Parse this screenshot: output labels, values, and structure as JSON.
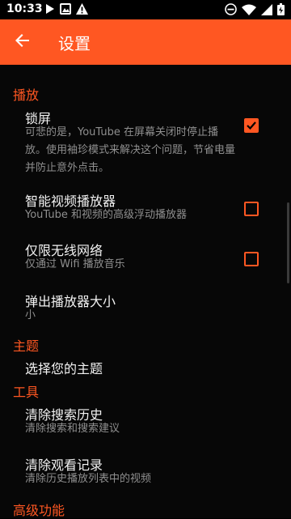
{
  "status_bar": {
    "time": "10:33",
    "left_icons": [
      "play-icon",
      "photo-icon",
      "warning-icon"
    ],
    "right_icons": [
      "dnd-icon",
      "wifi-icon",
      "signal-icon",
      "battery-icon"
    ]
  },
  "app_bar": {
    "title": "设置",
    "color": "#ff5722"
  },
  "sections": {
    "playback": {
      "title": "播放",
      "lockscreen": {
        "title": "锁屏",
        "desc": "可悲的是，YouTube 在屏幕关闭时停止播放。使用袖珍模式来解决这个问题，节省电量并防止意外点击。",
        "checked": true
      },
      "smart_player": {
        "title": "智能视频播放器",
        "desc": "YouTube 和视频的高级浮动播放器",
        "checked": false
      },
      "wifi_only": {
        "title": "仅限无线网络",
        "desc": "仅通过 Wifi 播放音乐",
        "checked": false
      },
      "popup_size": {
        "title": "弹出播放器大小",
        "value": "小"
      }
    },
    "theme": {
      "title": "主题",
      "choose": {
        "title": "选择您的主题"
      }
    },
    "tools": {
      "title": "工具",
      "clear_search": {
        "title": "清除搜索历史",
        "desc": "清除搜索和搜索建议"
      },
      "clear_history": {
        "title": "清除观看记录",
        "desc": "清除历史播放列表中的视频"
      }
    },
    "advanced": {
      "title": "高级功能"
    }
  }
}
